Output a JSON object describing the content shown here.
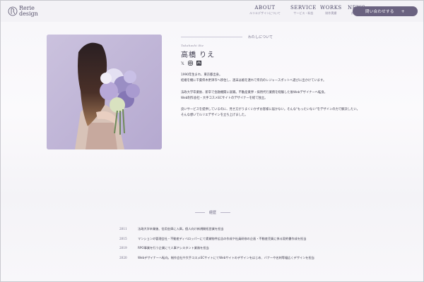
{
  "header": {
    "logo_line1": "Rerie",
    "logo_line2": "design",
    "nav": [
      {
        "en": "ABOUT",
        "jp": "ルリエデザインについて"
      },
      {
        "en": "SERVICE",
        "jp": "サービス・料金"
      },
      {
        "en": "WORKS",
        "jp": "制作実績"
      },
      {
        "en": "NEWS",
        "jp": "お知らせ"
      }
    ],
    "contact_label": "問い合わせする",
    "contact_icon": "plus-icon"
  },
  "profile": {
    "section_label": "わたしについて",
    "romaji": "Takahashi Rie",
    "name": "高橋 りえ",
    "social_icons": [
      "x-icon",
      "instagram-icon",
      "note-icon"
    ],
    "bio": [
      "1990年生まれ、東京都出身。",
      "結婚を機に千葉県木更津市へ移住し、週末は娘を連れて県内のレジャースポットへ遊びに出かけています。",
      "法政大学卒業後、新卒で金融機関に就職。不動産業界・採用代行業務を経験した後Webデザイナーへ転身。",
      "Web制作会社・大手コスメECサイトのデザイナーを経て独立。",
      "良いサービスを提供しているのに、見せ方がうまくいかずお客様に届かない。そんな\"もったいない\"をデザインの力で解決したい。",
      "そんな想いでルリエデザインを立ち上げました。"
    ]
  },
  "career": {
    "heading": "経歴",
    "items": [
      {
        "year": "2011",
        "text": "法政大学卒業後、信用金庫に入庫。個人向け新規開拓営業を担当"
      },
      {
        "year": "2015",
        "text": "マンションの管理会社・不動産ディベロッパーにて賃貸物件広告の作成や社員研修の企画・不動産売買に係る契約書作成を担当"
      },
      {
        "year": "2019",
        "text": "RPO事業を行う企業にて人事アシスタント業務を担当"
      },
      {
        "year": "2020",
        "text": "Webデザイナーへ転向。制作会社や大手コスメECサイトにてWebサイトのデザインをはじめ、バナーや名刺等幅広くデザインを担当"
      }
    ]
  }
}
